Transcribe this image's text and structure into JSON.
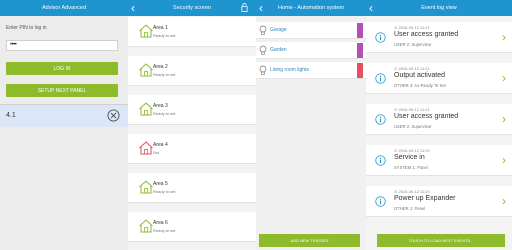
{
  "advisor": {
    "title": "Advisor Advanced",
    "pin_label": "Enter PIN to log in",
    "pin_value": "••••",
    "login_label": "LOG IN",
    "setup_label": "SETUP NEXT PANEL",
    "entry_value": "4.1"
  },
  "security": {
    "title": "Security screen",
    "areas": [
      {
        "name": "Area 1",
        "status": "Ready to set",
        "color": "#8dbb2c"
      },
      {
        "name": "Area 2",
        "status": "Ready to set",
        "color": "#8dbb2c"
      },
      {
        "name": "Area 3",
        "status": "Ready to set",
        "color": "#8dbb2c"
      },
      {
        "name": "Area 4",
        "status": "Set",
        "color": "#e05050"
      },
      {
        "name": "Area 5",
        "status": "Ready to set",
        "color": "#8dbb2c"
      },
      {
        "name": "Area 6",
        "status": "Ready to set",
        "color": "#8dbb2c"
      }
    ]
  },
  "automation": {
    "title": "Home - Automation system",
    "items": [
      {
        "name": "Garage",
        "bar_color": "#b44fb8"
      },
      {
        "name": "Garden",
        "bar_color": "#b44fb8"
      },
      {
        "name": "Living room lights",
        "bar_color": "#e85060"
      }
    ],
    "add_trigger_label": "ADD NEW TRIGGER"
  },
  "eventlog": {
    "title": "Event log view",
    "events": [
      {
        "timestamp": "2016-09-12 11:21",
        "title": "User access granted",
        "subtitle": "USER 2: Supervisor"
      },
      {
        "timestamp": "2016-09-12 11:21",
        "title": "Output activated",
        "subtitle": "OTHER 4: A1-Ready To Set"
      },
      {
        "timestamp": "2016-09-12 11:21",
        "title": "User access granted",
        "subtitle": "USER 2: Supervisor"
      },
      {
        "timestamp": "2016-09-12 11:20",
        "title": "Service in",
        "subtitle": "SYSTEM 1: Panel"
      },
      {
        "timestamp": "2016-09-12 11:20",
        "title": "Power up Expander",
        "subtitle": "OTHER 1: Panel"
      }
    ],
    "load_more_label": "TOUCH TO LOAD NEXT EVENTS..."
  },
  "colors": {
    "header": "#1e95cf",
    "accent_green": "#8dbb2c",
    "info_blue": "#1e95cf"
  }
}
